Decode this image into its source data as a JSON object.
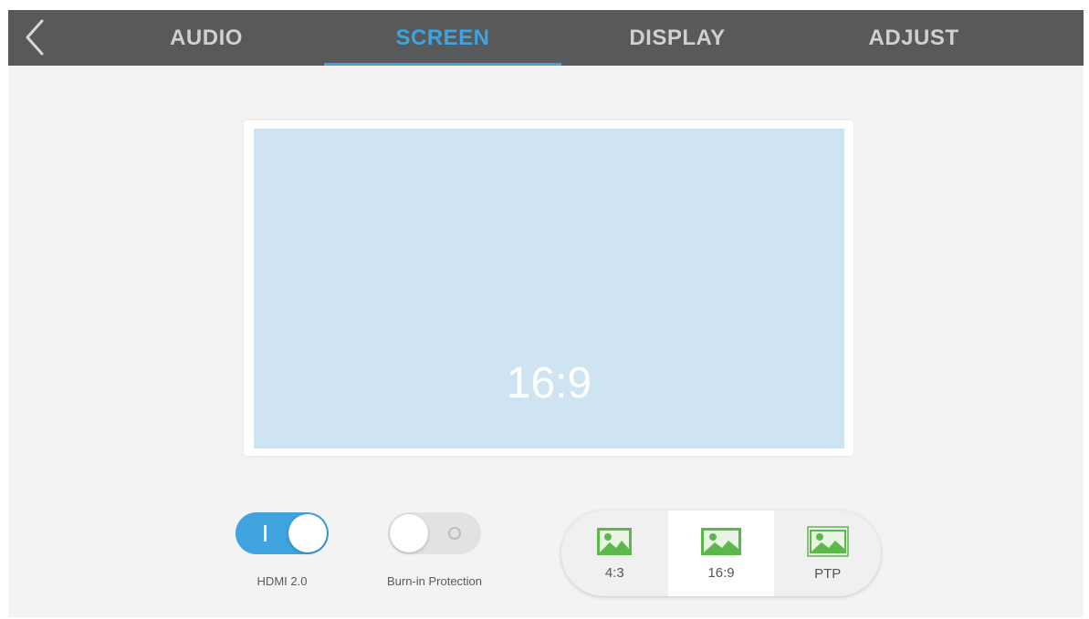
{
  "header": {
    "back_icon": "chevron-left-icon",
    "tabs": [
      {
        "label": "AUDIO",
        "active": false
      },
      {
        "label": "SCREEN",
        "active": true
      },
      {
        "label": "DISPLAY",
        "active": false
      },
      {
        "label": "ADJUST",
        "active": false
      }
    ]
  },
  "preview": {
    "label": "16:9"
  },
  "toggles": [
    {
      "label": "HDMI 2.0",
      "state": "on"
    },
    {
      "label": "Burn-in Protection",
      "state": "off"
    }
  ],
  "aspect": {
    "options": [
      {
        "label": "4:3",
        "icon": "image-icon"
      },
      {
        "label": "16:9",
        "icon": "image-icon",
        "selected": true
      },
      {
        "label": "PTP",
        "icon": "image-icon"
      }
    ]
  },
  "colors": {
    "accent": "#3ea3de",
    "topbar": "#58595b",
    "icon_green": "#5cb84a",
    "preview_bg": "#cfe4f2"
  }
}
